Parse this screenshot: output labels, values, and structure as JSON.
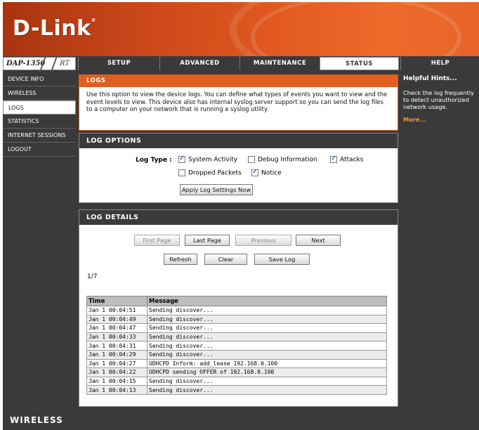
{
  "brand": {
    "logo": "D-Link",
    "model": "DAP-1350",
    "model_suffix": "RT"
  },
  "nav": {
    "tabs": [
      "SETUP",
      "ADVANCED",
      "MAINTENANCE",
      "STATUS",
      "HELP"
    ],
    "active": "STATUS"
  },
  "sidebar": {
    "items": [
      "DEVICE INFO",
      "WIRELESS",
      "LOGS",
      "STATISTICS",
      "INTERNET SESSIONS",
      "LOGOUT"
    ],
    "active": "LOGS"
  },
  "logs": {
    "title": "LOGS",
    "description": "Use this option to view the device logs. You can define what types of events you want to view and the event levels to view. This device also has internal syslog server support so you can send the log files to a computer on your network that is running a syslog utility."
  },
  "log_options": {
    "title": "LOG OPTIONS",
    "log_type_label": "Log Type :",
    "options": [
      {
        "label": "System Activity",
        "checked": true
      },
      {
        "label": "Debug Information",
        "checked": false
      },
      {
        "label": "Attacks",
        "checked": true
      },
      {
        "label": "Dropped Packets",
        "checked": false
      },
      {
        "label": "Notice",
        "checked": true
      }
    ],
    "apply_button": "Apply Log Settings Now"
  },
  "log_details": {
    "title": "LOG DETAILS",
    "buttons": {
      "first": "First Page",
      "last": "Last Page",
      "previous": "Previous",
      "next": "Next",
      "refresh": "Refresh",
      "clear": "Clear",
      "save": "Save Log"
    },
    "page_indicator": "1/7",
    "columns": [
      "Time",
      "Message"
    ],
    "rows": [
      {
        "time": "Jan 1 00:04:51",
        "message": "Sending discover..."
      },
      {
        "time": "Jan 1 00:04:49",
        "message": "Sending discover..."
      },
      {
        "time": "Jan 1 00:04:47",
        "message": "Sending discover..."
      },
      {
        "time": "Jan 1 00:04:33",
        "message": "Sending discover..."
      },
      {
        "time": "Jan 1 00:04:31",
        "message": "Sending discover..."
      },
      {
        "time": "Jan 1 00:04:29",
        "message": "Sending discover..."
      },
      {
        "time": "Jan 1 00:04:27",
        "message": "UDHCPD Inform: add_lease 192.168.0.100"
      },
      {
        "time": "Jan 1 00:04:22",
        "message": "UDHCPD sending OFFER of 192.168.0.100"
      },
      {
        "time": "Jan 1 00:04:15",
        "message": "Sending discover..."
      },
      {
        "time": "Jan 1 00:04:13",
        "message": "Sending discover..."
      }
    ]
  },
  "help": {
    "title": "Helpful Hints...",
    "text": "Check the log frequently to detect unauthorized network usage.",
    "more": "More..."
  },
  "footer": {
    "label": "WIRELESS"
  },
  "colors": {
    "accent": "#e05f1f",
    "dark": "#3a3a3a"
  }
}
